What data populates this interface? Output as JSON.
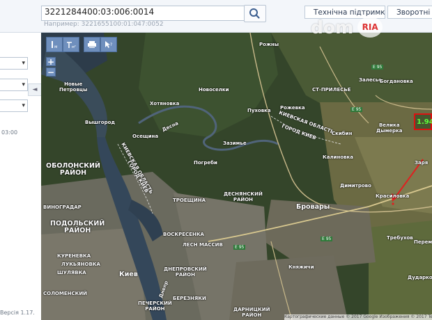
{
  "search": {
    "value": "3221284400:03:006:0014",
    "hint": "Например: 3221655100:01:047:0052"
  },
  "header": {
    "support_label": "Технічна підтримка",
    "feedback_label": "Зворотні"
  },
  "left_panel": {
    "time_text": "03:00",
    "version_text": "Версія 1.17.",
    "collapse_icon": "◄"
  },
  "map_toolbar": {
    "tools": [
      "measure-length",
      "measure-area",
      "print",
      "info"
    ]
  },
  "watermark": {
    "text": "dom",
    "badge": "RIA"
  },
  "marker": {
    "value": "1.94"
  },
  "copyright": "Картографические данные © 2017 Google Изображения © 2017 TerraMetrics",
  "places": {
    "rozhny": "Рожны",
    "zalesye": "Залесье",
    "bogdanovka": "Богдановка",
    "hotyanovka": "Хотяновка",
    "novoselki": "Новоселки",
    "novye_petrovtsy": "Новые\nПетровцы",
    "st_pryluki": "СТ-ПРИЛЕСЬЕ",
    "puhovka": "Пуховка",
    "rozhevka": "Рожевка",
    "vyshgorod": "Вышгород",
    "oseschina": "Осещина",
    "zazimye": "Зазимье",
    "kievskaya_oblast_1": "КИЕВСКАЯ ОБЛАСТЬ",
    "gorod_kiev_1": "ГОРОД КИЕВ",
    "skybyn": "Скибин",
    "velikaya_dymerka": "Велика\nДымерка",
    "kalinovka": "Калиновка",
    "zarya": "Заря",
    "pogrebi": "Погреби",
    "kievskaya_oblast_2": "КИЕВСКАЯ ОБЛАСТЬ",
    "gorod_kiev_2": "ГОРОД КИЕВ",
    "obolonsky": "ОБОЛОНСКИЙ\nРАЙОН",
    "desnyansky": "ДЕСНЯНСКИЙ\nРАЙОН",
    "dimitrovo": "Димитрово",
    "krasilovka": "Красиловка",
    "brovary": "Бровары",
    "troeshchina": "ТРОЕЩИНА",
    "vinogradar": "ВИНОГРАДАР",
    "podolsky": "ПОДОЛЬСКИЙ\nРАЙОН",
    "voskresenka": "ВОСКРЕСЕНКА",
    "les_massiv": "ЛЕСН МАССИВ",
    "trebuhov": "Требухов",
    "peremoga": "Перем",
    "kurenevka": "КУРЕНЕВКА",
    "lukyanovka": "ЛУКЬЯНОВКА",
    "shulyavka": "ШУЛЯВКА",
    "kiev": "Киев",
    "dneprovsky": "ДНЕПРОВСКИЙ\nРАЙОН",
    "knyazhichi": "Княжичи",
    "dudarkov": "Дударков",
    "solomenskiy": "СОЛОМЕНСКИЙ",
    "pechersky": "ПЕЧЕРСКИЙ\nРАЙОН",
    "berezniaki": "БЕРЕЗНЯКИ",
    "darnitsky": "ДАРНИЦКИЙ\nРАЙОН",
    "desna": "Десна",
    "dnepr": "Днепр"
  },
  "roads": {
    "e95_a": "E 95",
    "e95_b": "E 95",
    "e95_c": "E 95",
    "e95_d": "E 95"
  }
}
